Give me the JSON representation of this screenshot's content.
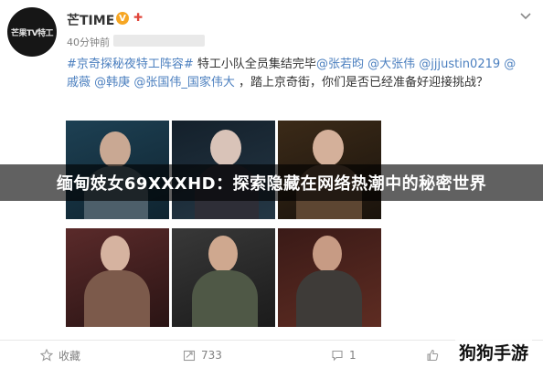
{
  "post": {
    "account_name": "芒TIME",
    "avatar_text": "芒果TV特工",
    "timestamp": "40分钟前",
    "content": [
      {
        "text": "#京奇探秘夜特工阵容#",
        "link": true
      },
      {
        "text": " 特工小队全员集结完毕",
        "link": false
      },
      {
        "text": "@张若昀",
        "link": true
      },
      {
        "text": " ",
        "link": false
      },
      {
        "text": "@大张伟",
        "link": true
      },
      {
        "text": " ",
        "link": false
      },
      {
        "text": "@jjjustin0219",
        "link": true
      },
      {
        "text": " ",
        "link": false
      },
      {
        "text": "@戚薇",
        "link": true
      },
      {
        "text": " ",
        "link": false
      },
      {
        "text": "@韩庚",
        "link": true
      },
      {
        "text": " ",
        "link": false
      },
      {
        "text": "@张国伟_国家伟大",
        "link": true
      },
      {
        "text": " ，踏上京奇街，你们是否已经准备好迎接挑战？",
        "link": false
      }
    ]
  },
  "overlay": {
    "banner_text": "缅甸妓女69XXXHD：探索隐藏在网络热潮中的秘密世界"
  },
  "actions": {
    "favorite_label": "收藏",
    "repost_count": "733",
    "comment_count": "1",
    "like_count": ""
  },
  "watermark": "狗狗手游",
  "colors": {
    "link": "#4b7fbf",
    "banner_bg": "#000000",
    "verified": "#f6a623"
  }
}
